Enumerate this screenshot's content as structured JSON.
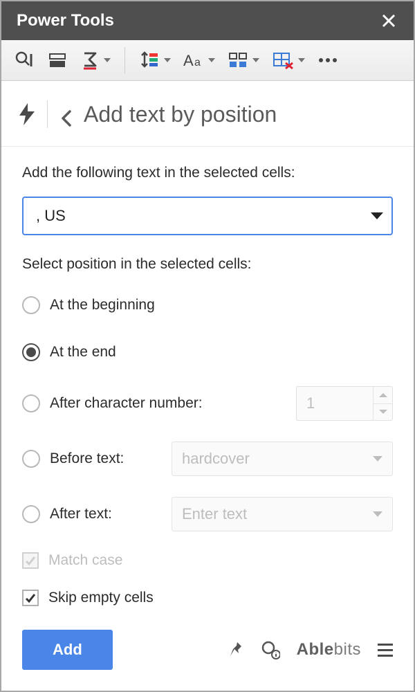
{
  "header": {
    "title": "Power Tools"
  },
  "section": {
    "title": "Add text by position"
  },
  "form": {
    "prompt_label": "Add the following text in the selected cells:",
    "text_value": ", US",
    "position_label": "Select position in the selected cells:",
    "radios": {
      "beginning": {
        "label": "At the beginning",
        "checked": false
      },
      "end": {
        "label": "At the end",
        "checked": true
      },
      "after_char": {
        "label": "After character number:",
        "checked": false,
        "value": "1"
      },
      "before_text": {
        "label": "Before text:",
        "checked": false,
        "placeholder": "hardcover"
      },
      "after_text": {
        "label": "After text:",
        "checked": false,
        "placeholder": "Enter text"
      }
    },
    "checks": {
      "match_case": {
        "label": "Match case",
        "checked": true,
        "disabled": true
      },
      "skip_empty": {
        "label": "Skip empty cells",
        "checked": true,
        "disabled": false
      }
    }
  },
  "footer": {
    "add_label": "Add",
    "brand_pre": "Able",
    "brand_post": "bits"
  }
}
